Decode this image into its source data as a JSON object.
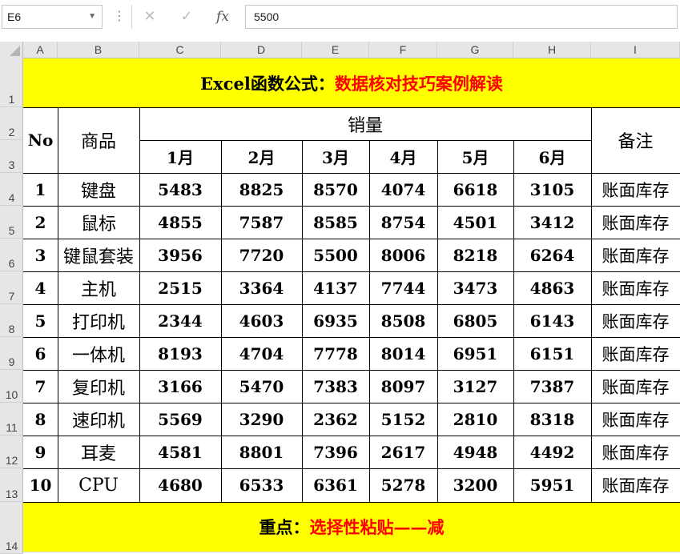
{
  "formula_bar": {
    "name_box": "E6",
    "formula": "5500"
  },
  "columns": [
    "A",
    "B",
    "C",
    "D",
    "E",
    "F",
    "G",
    "H",
    "I"
  ],
  "rows": [
    "1",
    "2",
    "3",
    "4",
    "5",
    "6",
    "7",
    "8",
    "9",
    "10",
    "11",
    "12",
    "13",
    "14"
  ],
  "title": {
    "black_part": "Excel函数公式：",
    "red_part": "数据核对技巧案例解读"
  },
  "table": {
    "header_no": "No",
    "header_product": "商品",
    "header_sales": "销量",
    "header_note": "备注",
    "months": [
      "1月",
      "2月",
      "3月",
      "4月",
      "5月",
      "6月"
    ],
    "records": [
      {
        "no": "1",
        "product": "键盘",
        "values": [
          "5483",
          "8825",
          "8570",
          "4074",
          "6618",
          "3105"
        ],
        "note": "账面库存"
      },
      {
        "no": "2",
        "product": "鼠标",
        "values": [
          "4855",
          "7587",
          "8585",
          "8754",
          "4501",
          "3412"
        ],
        "note": "账面库存"
      },
      {
        "no": "3",
        "product": "键鼠套装",
        "values": [
          "3956",
          "7720",
          "5500",
          "8006",
          "8218",
          "6264"
        ],
        "note": "账面库存"
      },
      {
        "no": "4",
        "product": "主机",
        "values": [
          "2515",
          "3364",
          "4137",
          "7744",
          "3473",
          "4863"
        ],
        "note": "账面库存"
      },
      {
        "no": "5",
        "product": "打印机",
        "values": [
          "2344",
          "4603",
          "6935",
          "8508",
          "6805",
          "6143"
        ],
        "note": "账面库存"
      },
      {
        "no": "6",
        "product": "一体机",
        "values": [
          "8193",
          "4704",
          "7778",
          "8014",
          "6951",
          "6151"
        ],
        "note": "账面库存"
      },
      {
        "no": "7",
        "product": "复印机",
        "values": [
          "3166",
          "5470",
          "7383",
          "8097",
          "3127",
          "7387"
        ],
        "note": "账面库存"
      },
      {
        "no": "8",
        "product": "速印机",
        "values": [
          "5569",
          "3290",
          "2362",
          "5152",
          "2810",
          "8318"
        ],
        "note": "账面库存"
      },
      {
        "no": "9",
        "product": "耳麦",
        "values": [
          "4581",
          "8801",
          "7396",
          "2617",
          "4948",
          "4492"
        ],
        "note": "账面库存"
      },
      {
        "no": "10",
        "product": "CPU",
        "values": [
          "4680",
          "6533",
          "6361",
          "5278",
          "3200",
          "5951"
        ],
        "note": "账面库存"
      }
    ]
  },
  "footer": {
    "black_part": "重点：",
    "red_part": "选择性粘贴——减"
  },
  "colors": {
    "highlight": "#ffff00",
    "title_red": "#ff0000"
  }
}
